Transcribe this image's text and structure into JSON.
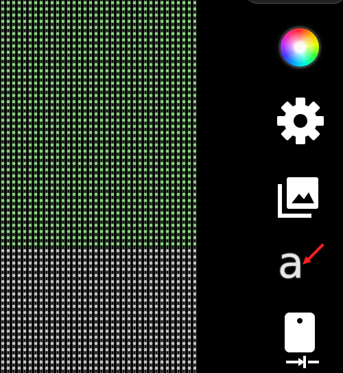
{
  "canvas": {
    "green_pattern_name": "green-dot-pattern",
    "gray_pattern_name": "gray-dot-pattern",
    "green_color": "#8ccf83",
    "gray_color": "#c4c4c4"
  },
  "sidebar": {
    "background": "#000000",
    "items": [
      {
        "name": "color-wheel-button",
        "icon": "color-wheel-icon"
      },
      {
        "name": "settings-button",
        "icon": "gear-icon"
      },
      {
        "name": "gallery-button",
        "icon": "gallery-icon"
      },
      {
        "name": "font-button",
        "icon": "font-arrow-icon",
        "accent": "#ff1f1f"
      },
      {
        "name": "device-button",
        "icon": "device-transfer-icon"
      }
    ]
  },
  "font_button": {
    "letter": "a"
  }
}
